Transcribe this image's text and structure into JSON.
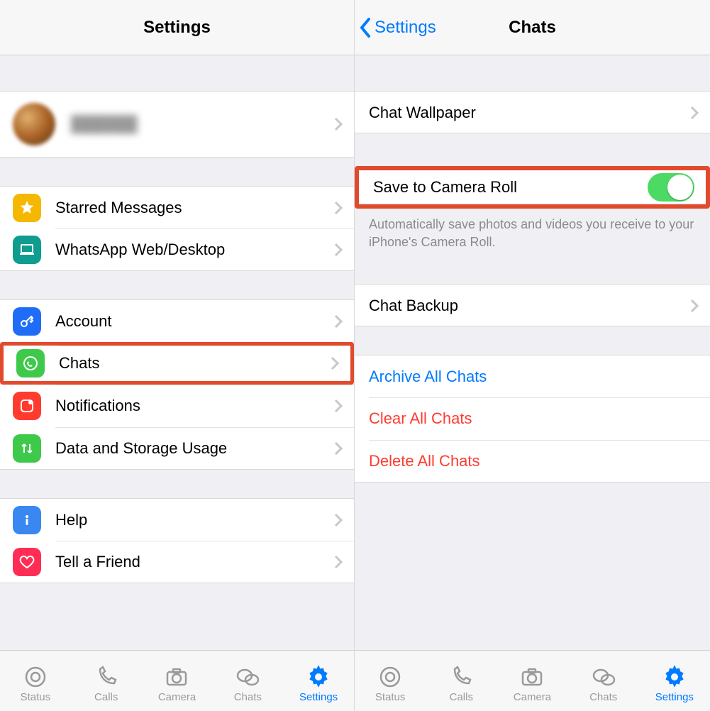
{
  "left": {
    "nav_title": "Settings",
    "items": {
      "starred": "Starred Messages",
      "web": "WhatsApp Web/Desktop",
      "account": "Account",
      "chats": "Chats",
      "notifications": "Notifications",
      "data": "Data and Storage Usage",
      "help": "Help",
      "tell": "Tell a Friend"
    }
  },
  "right": {
    "nav_back": "Settings",
    "nav_title": "Chats",
    "wallpaper": "Chat Wallpaper",
    "save_camera": "Save to Camera Roll",
    "save_desc": "Automatically save photos and videos you receive to your iPhone's Camera Roll.",
    "backup": "Chat Backup",
    "archive": "Archive All Chats",
    "clear": "Clear All Chats",
    "delete": "Delete All Chats"
  },
  "tabs": {
    "status": "Status",
    "calls": "Calls",
    "camera": "Camera",
    "chats": "Chats",
    "settings": "Settings"
  }
}
